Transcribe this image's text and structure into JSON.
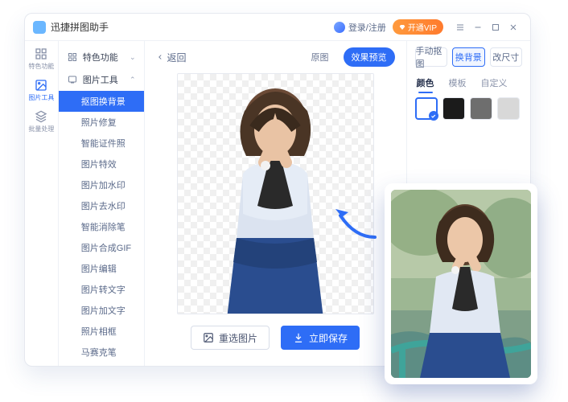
{
  "app": {
    "title": "迅捷拼图助手",
    "login": "登录/注册",
    "vip": "开通VIP"
  },
  "tabstrip": [
    {
      "icon": "grid",
      "label": "特色功能"
    },
    {
      "icon": "image",
      "label": "图片工具"
    },
    {
      "icon": "batch",
      "label": "批量处理"
    }
  ],
  "sidebar": {
    "group1": {
      "label": "特色功能"
    },
    "group2": {
      "label": "图片工具"
    },
    "items": [
      "抠图换背景",
      "照片修复",
      "智能证件照",
      "图片特效",
      "图片加水印",
      "图片去水印",
      "智能消除笔",
      "图片合成GIF",
      "图片编辑",
      "图片转文字",
      "图片加文字",
      "照片相框",
      "马赛克笔"
    ]
  },
  "toolbar": {
    "back": "返回",
    "original": "原图",
    "preview": "效果预览"
  },
  "actions": {
    "rechoose": "重选图片",
    "save": "立即保存"
  },
  "right": {
    "modes": [
      "手动抠图",
      "换背景",
      "改尺寸"
    ],
    "subtabs": [
      "颜色",
      "模板",
      "自定义"
    ],
    "colors": [
      "#ffffff",
      "#1b1b1b",
      "#6e6e6e",
      "#d8d8d8"
    ]
  }
}
